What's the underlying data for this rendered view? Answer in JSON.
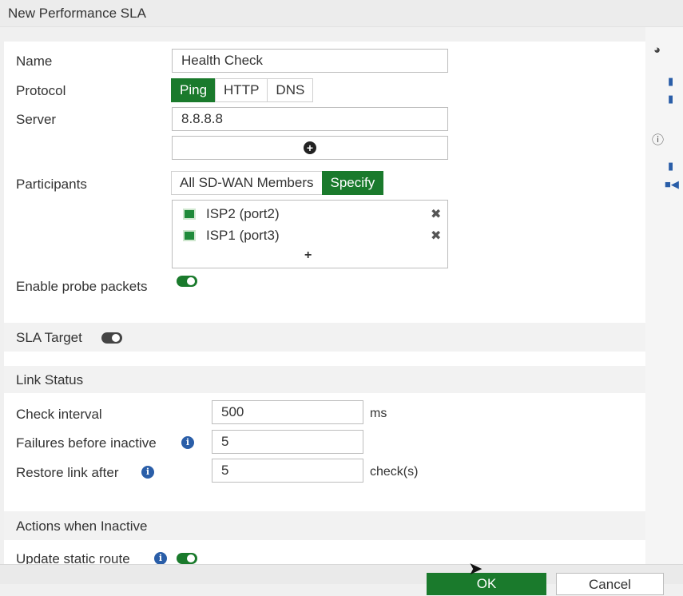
{
  "dialog": {
    "title": "New Performance SLA"
  },
  "form": {
    "name_label": "Name",
    "name_value": "Health Check",
    "protocol_label": "Protocol",
    "protocol_options": [
      "Ping",
      "HTTP",
      "DNS"
    ],
    "protocol_selected": "Ping",
    "server_label": "Server",
    "server_value": "8.8.8.8",
    "participants_label": "Participants",
    "participants_options": [
      "All SD-WAN Members",
      "Specify"
    ],
    "participants_selected": "Specify",
    "members": [
      {
        "name": "ISP2 (port2)"
      },
      {
        "name": "ISP1 (port3)"
      }
    ],
    "add_member_glyph": "+",
    "probe_label": "Enable probe packets",
    "probe_enabled": true
  },
  "sla_target": {
    "label": "SLA Target",
    "enabled": false
  },
  "link_status": {
    "title": "Link Status",
    "check_interval_label": "Check interval",
    "check_interval_value": "500",
    "check_interval_unit": "ms",
    "failures_label": "Failures before inactive",
    "failures_value": "5",
    "restore_label": "Restore link after",
    "restore_value": "5",
    "restore_unit": "check(s)"
  },
  "actions": {
    "title": "Actions when Inactive",
    "update_static_route_label": "Update static route",
    "update_static_route_enabled": true
  },
  "footer": {
    "ok_label": "OK",
    "cancel_label": "Cancel"
  },
  "right_pane": {
    "icons": [
      "dashboard-icon",
      "book-icon",
      "book-icon",
      "help-icon",
      "book-icon",
      "video-icon"
    ]
  },
  "colors": {
    "accent": "#1a7a2c",
    "info": "#2a5ea8"
  }
}
